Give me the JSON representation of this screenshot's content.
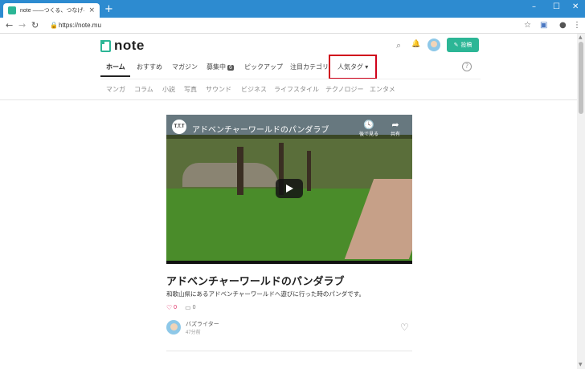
{
  "browser": {
    "tab_title": "note ——つくる、つなげる、とどける。",
    "tab_close": "×",
    "new_tab": "+",
    "window_controls": {
      "minimize": "–",
      "maximize": "☐",
      "close": "✕"
    },
    "nav": {
      "back": "←",
      "forward": "→",
      "reload": "↻"
    },
    "lock": "🔒",
    "url": "https://note.mu",
    "toolbar_icons": {
      "star": "☆",
      "extension": "▣",
      "profile": "●",
      "menu": "⋮"
    }
  },
  "site": {
    "logo_text": "note",
    "header_icons": {
      "search": "⌕",
      "bell": "🔔"
    },
    "post_button_icon": "✎",
    "post_button_label": "投稿",
    "main_nav": [
      {
        "label": "ホーム"
      },
      {
        "label": "おすすめ"
      },
      {
        "label": "マガジン"
      },
      {
        "label": "募集中",
        "badge": "6"
      },
      {
        "label": "ピックアップ"
      },
      {
        "label": "注目カテゴリ"
      },
      {
        "label": "人気タグ",
        "caret": "▾"
      }
    ],
    "help": "?",
    "sub_nav": [
      "マンガ",
      "コラム",
      "小説",
      "写真",
      "サウンド",
      "ビジネス",
      "ライフスタイル",
      "テクノロジー",
      "エンタメ"
    ]
  },
  "article": {
    "video": {
      "channel_icon": "T.T.T",
      "title": "アドベンチャーワールドのパンダラブ",
      "watch_later_icon": "🕓",
      "watch_later_label": "後で見る",
      "share_icon": "➦",
      "share_label": "共有"
    },
    "title": "アドベンチャーワールドのパンダラブ",
    "description": "和歌山県にあるアドベンチャーワールドへ遊びに行った時のパンダです。",
    "like_icon": "♡",
    "likes": "0",
    "comment_icon": "▭",
    "comments": "0",
    "author": "バズライター",
    "time": "47分前",
    "save_icon": "♡"
  },
  "scrollbar": {
    "up": "▲",
    "down": "▼"
  }
}
